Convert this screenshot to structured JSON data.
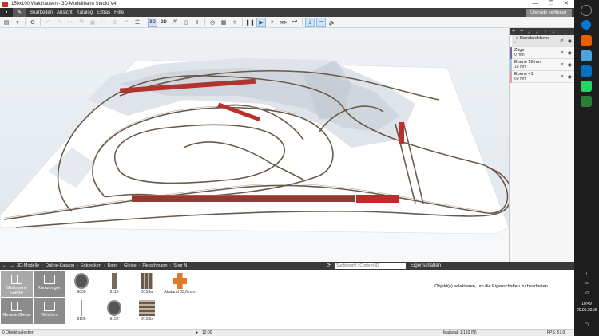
{
  "window": {
    "title": "150x100 Waldhausen - 3D-Modellbahn Studio V4",
    "controls": [
      "—",
      "❐",
      "✕"
    ]
  },
  "menu": {
    "items": [
      "Bearbeiten",
      "Ansicht",
      "Katalog",
      "Extras",
      "Hilfe"
    ],
    "upgrade": "Upgrade verfügbar"
  },
  "toolbar": {
    "mode3d": "3D",
    "mode2d": "2D"
  },
  "layers": {
    "items": [
      {
        "name": "-> Standardebene",
        "height": "-",
        "color": "#ffffff"
      },
      {
        "name": "Züge",
        "height": "0 mm",
        "color": "#7b5fb5"
      },
      {
        "name": "Ebene 18mm",
        "height": "18 mm",
        "color": "#9ec4e6"
      },
      {
        "name": "Ebene +1",
        "height": "60 mm",
        "color": "#e89aa8"
      }
    ]
  },
  "catalog": {
    "breadcrumb": [
      "3D-Modelle",
      "Online-Katalog",
      "Entdecken",
      "Bahn",
      "Gleise",
      "Fleischmann",
      "Spur N"
    ],
    "search_placeholder": "Suchbegriff / Content-ID",
    "categories": [
      "Gebogene Gleise",
      "Kreuzungen",
      "Gerade Gleise",
      "Weichen"
    ],
    "items": [
      {
        "label": "9050"
      },
      {
        "label": "9116"
      },
      {
        "label": "9153a"
      },
      {
        "label": "Abstand 33,6 mm"
      },
      {
        "label": "9106"
      },
      {
        "label": "9152"
      },
      {
        "label": "9153b"
      }
    ]
  },
  "properties": {
    "title": "Eigenschaften",
    "hint": "Objekt(e) selektieren, um die Eigenschaften zu bearbeiten"
  },
  "status": {
    "selection": "0 Objekt selektiert",
    "time": "12:00",
    "scale": "Maßstab 1:160 (N)",
    "fps": "FPS: 57,0"
  },
  "taskbar": {
    "time": "10:49",
    "date": "20.01.2018"
  }
}
